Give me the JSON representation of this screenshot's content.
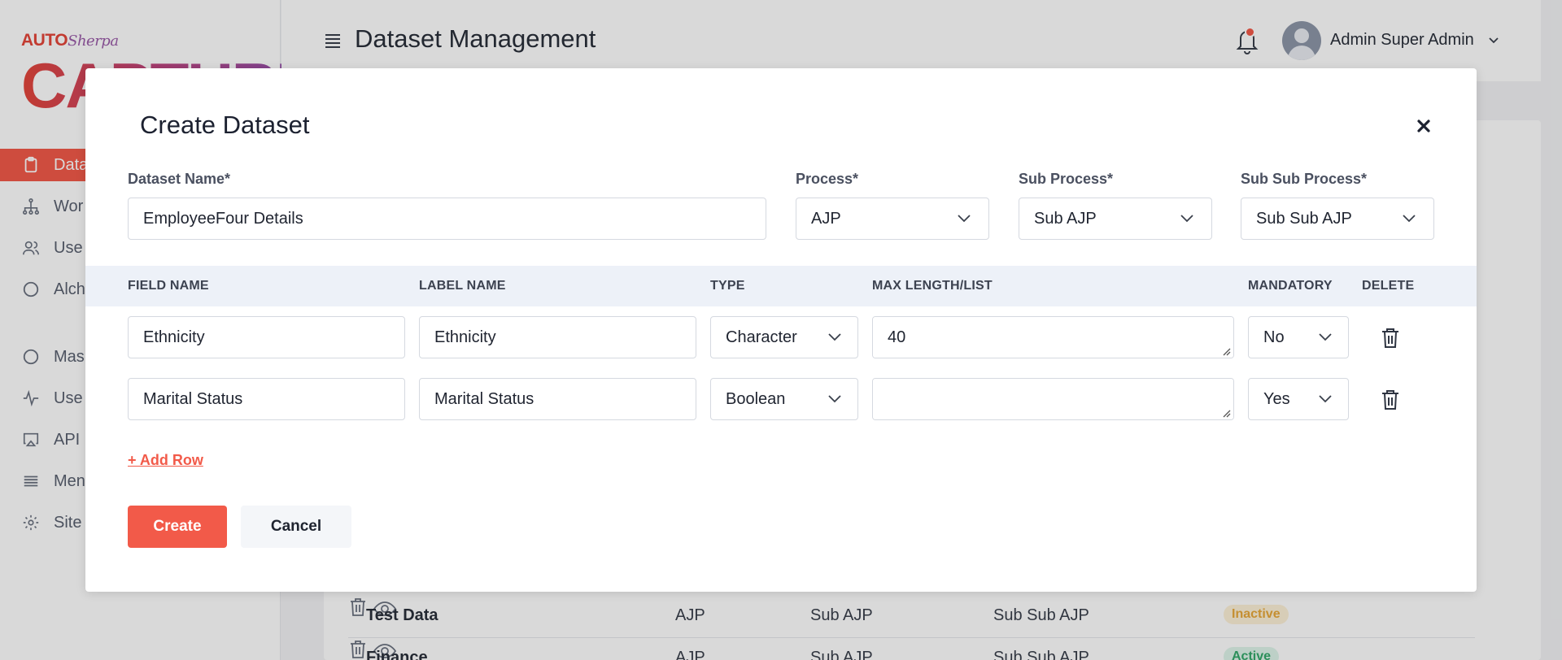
{
  "brand": {
    "logo_top": "AUTO",
    "logo_top_script": "Sherpa",
    "logo_main": "CAPTURE",
    "logo_main_visible": "CAPTURE"
  },
  "sidebar": {
    "items": [
      {
        "label": "Datasets",
        "visible": "Data",
        "icon": "clipboard-icon",
        "active": true
      },
      {
        "label": "Workflows",
        "visible": "Wor",
        "icon": "hierarchy-icon"
      },
      {
        "label": "Users",
        "visible": "Use",
        "icon": "users-icon"
      },
      {
        "label": "Alchemy",
        "visible": "Alch",
        "icon": "circle-icon"
      },
      {
        "label": "Masters",
        "visible": "Mas",
        "icon": "circle-icon"
      },
      {
        "label": "Usage",
        "visible": "Use",
        "icon": "activity-icon"
      },
      {
        "label": "API",
        "visible": "API",
        "icon": "airplay-icon"
      },
      {
        "label": "Menu",
        "visible": "Men",
        "icon": "list-icon"
      },
      {
        "label": "Site",
        "visible": "Site",
        "icon": "gear-icon"
      }
    ]
  },
  "header": {
    "title": "Dataset Management",
    "user_name": "Admin Super Admin"
  },
  "background_table": {
    "rows": [
      {
        "name": "Test Data",
        "process": "AJP",
        "sub_process": "Sub AJP",
        "sub_sub_process": "Sub Sub AJP",
        "status": "Inactive"
      },
      {
        "name": "Finance",
        "process": "AJP",
        "sub_process": "Sub AJP",
        "sub_sub_process": "Sub Sub AJP",
        "status": "Active"
      }
    ]
  },
  "modal": {
    "title": "Create Dataset",
    "fields": {
      "dataset_name_label": "Dataset Name*",
      "dataset_name_value": "EmployeeFour Details",
      "process_label": "Process*",
      "process_value": "AJP",
      "sub_process_label": "Sub Process*",
      "sub_process_value": "Sub AJP",
      "sub_sub_process_label": "Sub Sub Process*",
      "sub_sub_process_value": "Sub Sub AJP"
    },
    "table": {
      "headers": {
        "field_name": "FIELD NAME",
        "label_name": "LABEL NAME",
        "type": "TYPE",
        "max_length": "MAX LENGTH/LIST",
        "mandatory": "MANDATORY",
        "delete": "DELETE"
      },
      "rows": [
        {
          "field_name": "Ethnicity",
          "label_name": "Ethnicity",
          "type": "Character",
          "max_length": "40",
          "mandatory": "No"
        },
        {
          "field_name": "Marital Status",
          "label_name": "Marital Status",
          "type": "Boolean",
          "max_length": "",
          "mandatory": "Yes"
        }
      ]
    },
    "add_row_label": "+ Add Row",
    "create_label": "Create",
    "cancel_label": "Cancel"
  },
  "colors": {
    "accent": "#f25a49",
    "table_header_bg": "#edf1f8",
    "inactive": "#e8a83a",
    "active": "#33a86a"
  }
}
